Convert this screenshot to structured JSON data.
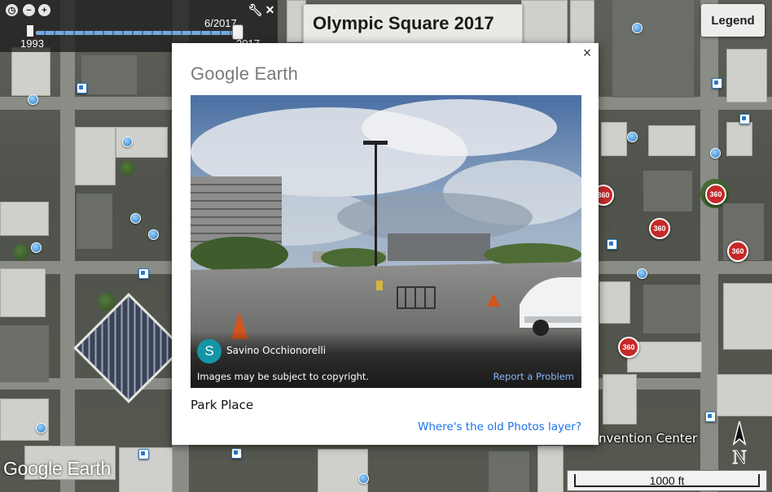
{
  "time_slider": {
    "start_year": "1993",
    "current_date": "6/2017",
    "end_year": "2017",
    "position_fraction": 0.99,
    "buttons": [
      "clock-icon",
      "zoom-out-icon",
      "zoom-in-icon",
      "wrench-icon",
      "close-icon"
    ]
  },
  "tour_title": "Olympic Square 2017",
  "legend_label": "Legend",
  "popup": {
    "brand_google": "Google",
    "brand_earth": "Earth",
    "close_glyph": "×",
    "author_initial": "S",
    "author_name": "Savino Occhionorelli",
    "copyright_notice": "Images may be subject to copyright.",
    "report_link": "Report a Problem",
    "place_name": "Park Place",
    "old_photos_link": "Where's the old Photos layer?"
  },
  "map": {
    "watermark": "Google Earth",
    "street_label": "nvention Center",
    "compass_letter": "N",
    "scale_label": "1000 ft",
    "marker_360_label": "360"
  }
}
